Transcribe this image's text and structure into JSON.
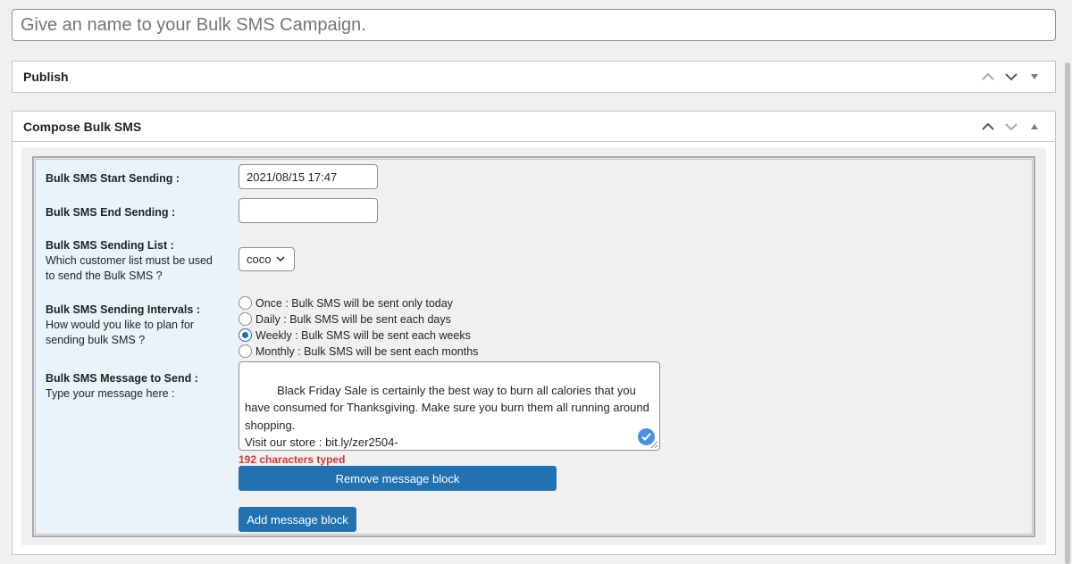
{
  "title_input": {
    "placeholder": "Give an name to your Bulk SMS Campaign."
  },
  "publish_box": {
    "title": "Publish",
    "controls": [
      "chevron-up-icon",
      "chevron-down-icon",
      "caret-down-icon"
    ]
  },
  "compose_box": {
    "title": "Compose Bulk SMS",
    "controls": [
      "chevron-up-icon",
      "chevron-down-icon",
      "caret-up-icon"
    ]
  },
  "form": {
    "start": {
      "label": "Bulk SMS Start Sending :",
      "value": "2021/08/15 17:47"
    },
    "end": {
      "label": "Bulk SMS End Sending :",
      "value": ""
    },
    "list": {
      "label": "Bulk SMS Sending List :",
      "help_line1": "Which customer list must be used",
      "help_line2": "to send the Bulk SMS ?",
      "selected": "coco"
    },
    "intervals": {
      "label": "Bulk SMS Sending Intervals :",
      "help_line1": "How would you like to plan for",
      "help_line2": "sending bulk SMS ?",
      "options": [
        {
          "label": "Once : Bulk SMS will be sent only today",
          "checked": false
        },
        {
          "label": "Daily : Bulk SMS will be sent each days",
          "checked": false
        },
        {
          "label": "Weekly : Bulk SMS will be sent each weeks",
          "checked": true
        },
        {
          "label": "Monthly : Bulk SMS will be sent each months",
          "checked": false
        }
      ]
    },
    "message": {
      "label": "Bulk SMS Message to Send :",
      "help": "Type your message here :",
      "text": "Black Friday Sale is certainly the best way to burn all calories that you have consumed for Thanksgiving. Make sure you burn them all running around shopping.\nVisit our store : bit.ly/zer2504-",
      "count": "192 characters typed"
    },
    "remove_button": "Remove message block",
    "add_button": "Add message block"
  },
  "colors": {
    "primary": "#2271b1",
    "error": "#d63638",
    "label_bg": "#eaf2fa"
  }
}
